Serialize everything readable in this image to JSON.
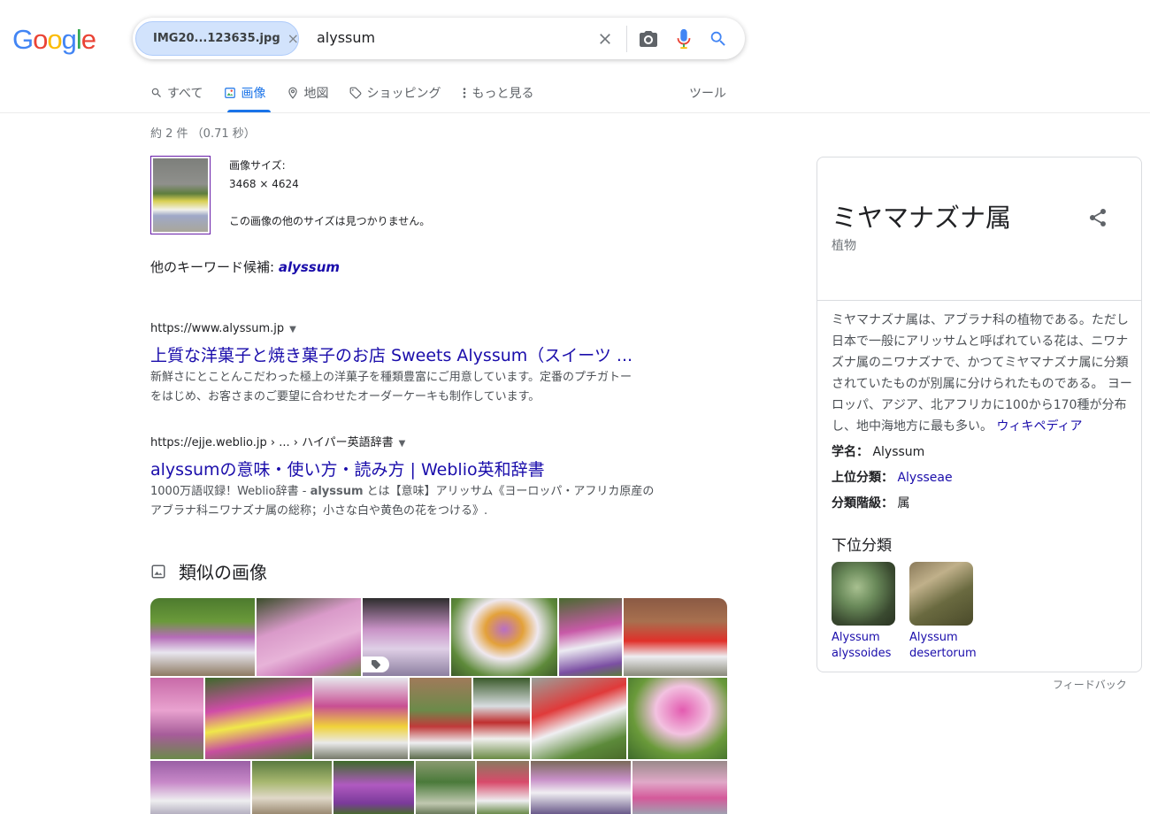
{
  "logo": {
    "letters": [
      "G",
      "o",
      "o",
      "g",
      "l",
      "e"
    ],
    "colors": [
      "#4285f4",
      "#ea4335",
      "#fbbc05",
      "#4285f4",
      "#34a853",
      "#ea4335"
    ]
  },
  "search": {
    "chip_label": "IMG20...123635.jpg",
    "chip_close": "×",
    "query": "alyssum"
  },
  "tabs": [
    {
      "label": "すべて",
      "icon": "search-icon"
    },
    {
      "label": "画像",
      "icon": "image-icon",
      "active": true
    },
    {
      "label": "地図",
      "icon": "map-pin-icon"
    },
    {
      "label": "ショッピング",
      "icon": "tag-icon"
    },
    {
      "label": "もっと見る",
      "icon": "more-vert-icon"
    }
  ],
  "tools_label": "ツール",
  "stats": "約 2 件 （0.71 秒）",
  "image_info": {
    "size_label": "画像サイズ:",
    "size_value": "3468 × 4624",
    "note": "この画像の他のサイズは見つかりません。"
  },
  "keyword": {
    "label": "他のキーワード候補: ",
    "value": "alyssum"
  },
  "results": [
    {
      "url": "https://www.alyssum.jp",
      "title": "上質な洋菓子と焼き菓子のお店 Sweets Alyssum（スイーツ ...",
      "snippet_line1": "新鮮さにとことんこだわった極上の洋菓子を種類豊富にご用意しています。定番のプチガトー",
      "snippet_line2": "をはじめ、お客さまのご要望に合わせたオーダーケーキも制作しています。"
    },
    {
      "url": "https://ejje.weblio.jp › ... › ハイパー英語辞書",
      "title": "alyssumの意味・使い方・読み方 | Weblio英和辞書",
      "snippet_line1_a": "1000万語収録！Weblio辞書 - ",
      "snippet_line1_b": "alyssum",
      "snippet_line1_c": " とは【意味】アリッサム《ヨーロッパ・アフリカ原産の",
      "snippet_line2": "アブラナ科ニワナズナ属の総称；小さな白や黄色の花をつける》."
    }
  ],
  "similar": {
    "heading": "類似の画像"
  },
  "knowledge_panel": {
    "title": "ミヤマナズナ属",
    "subtitle": "植物",
    "description": "ミヤマナズナ属は、アブラナ科の植物である。ただし日本で一般にアリッサムと呼ばれている花は、ニワナズナ属のニワナズナで、かつてミヤマナズナ属に分類されていたものが別属に分けられたものである。 ヨーロッパ、アジア、北アフリカに100から170種が分布し、地中海地方に最も多い。",
    "source_link": "ウィキペディア",
    "facts": [
      {
        "label": "学名：",
        "value": "Alyssum",
        "link": false
      },
      {
        "label": "上位分類：",
        "value": "Alysseae",
        "link": true
      },
      {
        "label": "分類階級：",
        "value": "属",
        "link": false
      }
    ],
    "sub_heading": "下位分類",
    "sub_items": [
      {
        "line1": "Alyssum",
        "line2": "alyssoides"
      },
      {
        "line1": "Alyssum",
        "line2": "desertorum"
      }
    ]
  },
  "feedback": "フィードバック"
}
